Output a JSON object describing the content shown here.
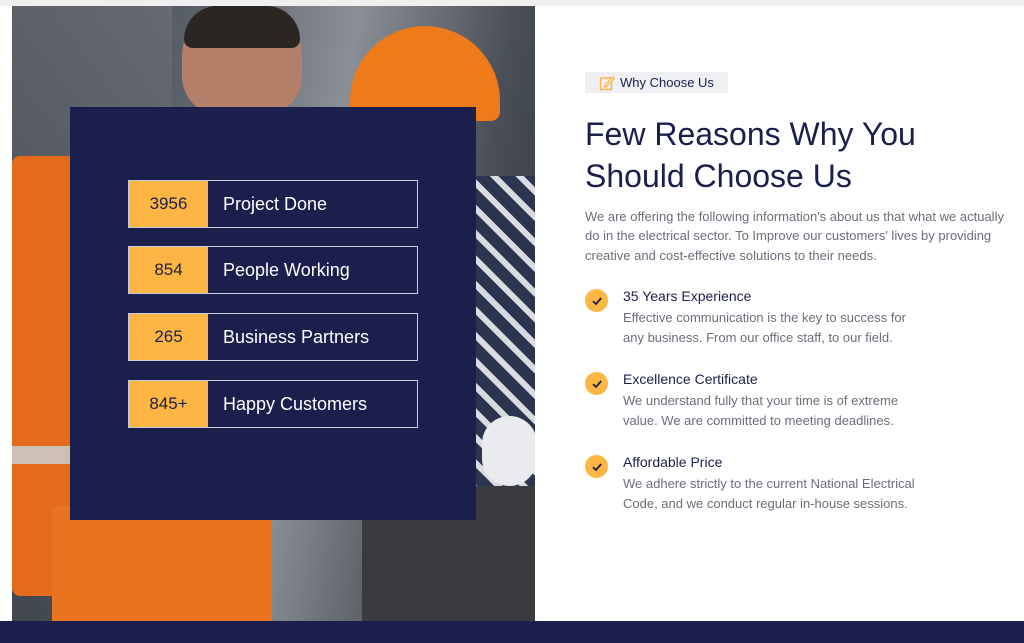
{
  "colors": {
    "navy": "#1b1f4b",
    "accent": "#fdb643",
    "muted_text": "#6b6e7a"
  },
  "image": {
    "semantic": "construction-workers-photo"
  },
  "stats": [
    {
      "number": "3956",
      "label": "Project Done"
    },
    {
      "number": "854",
      "label": "People Working"
    },
    {
      "number": "265",
      "label": "Business Partners"
    },
    {
      "number": "845+",
      "label": "Happy Customers"
    }
  ],
  "section": {
    "badge_icon": "pencil-edit-icon",
    "badge_label": "Why Choose Us",
    "heading_line1": "Few Reasons Why You",
    "heading_line2": "Should Choose Us",
    "intro": "We are offering the following information's about us that what we actually do in the electrical sector. To Improve our customers' lives by providing creative and cost-effective solutions to their needs."
  },
  "features": [
    {
      "icon": "check-circle-icon",
      "title": "35 Years Experience",
      "line1": "Effective communication is the key to success for",
      "line2": "any business. From our office staff, to our field."
    },
    {
      "icon": "check-circle-icon",
      "title": "Excellence Certificate",
      "line1": "We understand fully that your time is of extreme",
      "line2": "value. We are committed to meeting deadlines."
    },
    {
      "icon": "check-circle-icon",
      "title": "Affordable Price",
      "line1": "We adhere strictly to the current National Electrical",
      "line2": "Code, and we conduct regular in-house sessions."
    }
  ]
}
